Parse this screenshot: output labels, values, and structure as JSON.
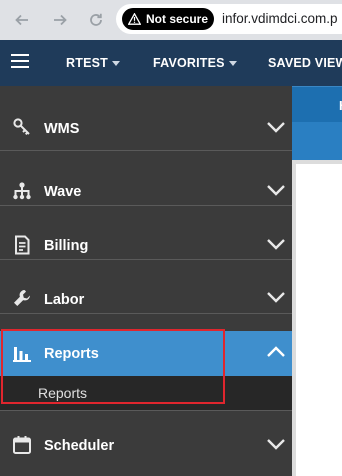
{
  "browser": {
    "security_label": "Not secure",
    "url": "infor.vdimdci.com.p"
  },
  "header": {
    "menus": [
      {
        "label": "RTEST"
      },
      {
        "label": "FAVORITES"
      },
      {
        "label": "SAVED VIEW"
      }
    ],
    "bg_color": "#1f3b5a"
  },
  "content": {
    "tab_initial": "H",
    "accent_color": "#1d6fb0"
  },
  "sidebar": {
    "items": [
      {
        "label": "WMS",
        "icon": "key-icon",
        "expanded": false
      },
      {
        "label": "Wave",
        "icon": "hierarchy-icon",
        "expanded": false
      },
      {
        "label": "Billing",
        "icon": "invoice-icon",
        "expanded": false
      },
      {
        "label": "Labor",
        "icon": "wrench-icon",
        "expanded": false
      },
      {
        "label": "Reports",
        "icon": "bar-chart-icon",
        "expanded": true,
        "children": [
          {
            "label": "Reports"
          }
        ]
      },
      {
        "label": "Scheduler",
        "icon": "calendar-icon",
        "expanded": false
      }
    ],
    "active_color": "#3f8fcd"
  },
  "annotation": {
    "highlight_color": "#e0262e"
  }
}
